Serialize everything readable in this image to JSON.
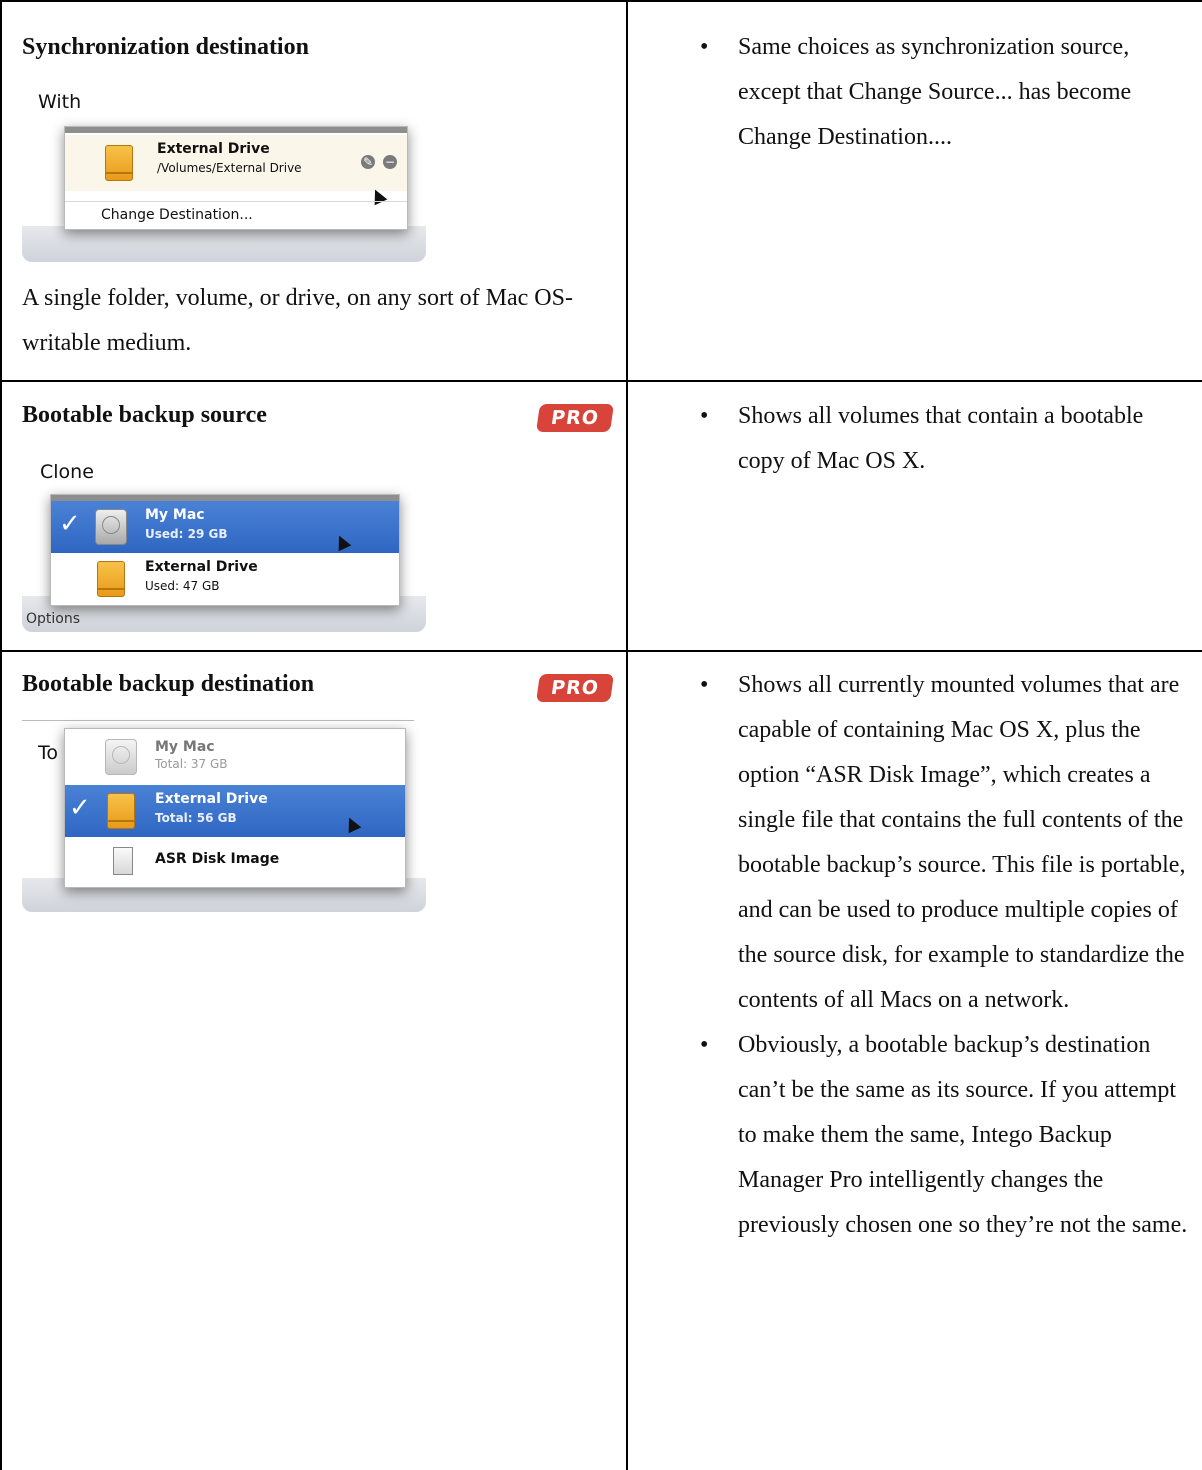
{
  "rows": [
    {
      "title": "Synchronization destination",
      "ui_label": "With",
      "items": [
        {
          "name": "External Drive",
          "sub": "/Volumes/External Drive",
          "icon": "external-drive-icon"
        }
      ],
      "menu_command": "Change Destination...",
      "body": "A single folder, volume, or drive, on any sort of Mac OS-writable medium.",
      "bullets": [
        "Same choices as synchronization source, except that Change Source... has become Change Destination...."
      ]
    },
    {
      "title": "Bootable backup source",
      "badge": "PRO",
      "ui_label": "Clone",
      "items": [
        {
          "name": "My Mac",
          "sub": "Used: 29 GB",
          "icon": "hard-disk-icon",
          "selected": true
        },
        {
          "name": "External Drive",
          "sub": "Used: 47 GB",
          "icon": "external-drive-icon"
        }
      ],
      "tray_label": "Options",
      "bullets": [
        "Shows all volumes that contain a bootable copy of Mac OS X."
      ]
    },
    {
      "title": "Bootable backup destination",
      "badge": "PRO",
      "ui_label": "To",
      "items": [
        {
          "name": "My Mac",
          "sub": "Total: 37 GB",
          "icon": "hard-disk-icon",
          "disabled": true
        },
        {
          "name": "External Drive",
          "sub": "Total: 56 GB",
          "icon": "external-drive-icon",
          "selected": true
        },
        {
          "name": "ASR Disk Image",
          "sub": "",
          "icon": "disk-image-icon"
        }
      ],
      "bullets": [
        "Shows all currently mounted volumes that are capable of containing Mac OS X, plus the option “ASR Disk Image”, which creates a single file that contains the full contents of the bootable backup’s source. This file is portable, and can be used to produce multiple copies of the source disk, for example to standardize the contents of all Macs on a network.",
        "Obviously, a bootable backup’s destination can’t be the same as its source. If you attempt to make them the same, Intego Backup Manager Pro intelligently changes the previously chosen one so they’re not the same."
      ]
    }
  ],
  "glyphs": {
    "bullet": "•",
    "check": "✓",
    "edit": "✎",
    "minus": "−"
  }
}
